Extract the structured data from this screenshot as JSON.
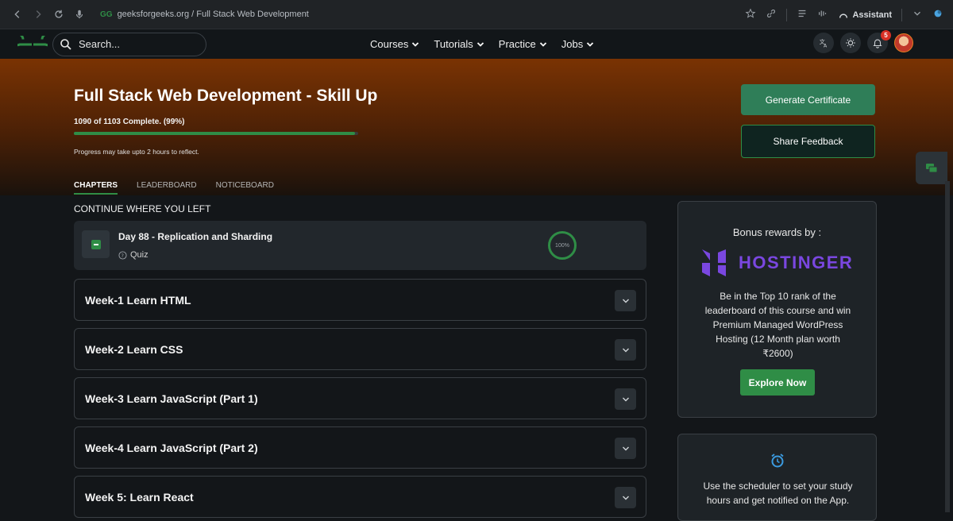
{
  "browser": {
    "url": "geeksforgeeks.org / Full Stack Web Development",
    "assistant_label": "Assistant"
  },
  "header": {
    "search_placeholder": "Search...",
    "menu": [
      {
        "label": "Courses"
      },
      {
        "label": "Tutorials"
      },
      {
        "label": "Practice"
      },
      {
        "label": "Jobs"
      }
    ],
    "notification_count": "5",
    "brand_color": "#2f8d46"
  },
  "hero": {
    "title": "Full Stack Web Development - Skill Up",
    "progress_text": "1090 of 1103 Complete. (99%)",
    "progress_fraction": 0.99,
    "progress_note": "Progress may take upto 2 hours to reflect.",
    "generate_certificate": "Generate Certificate",
    "share_feedback": "Share Feedback",
    "tabs": [
      {
        "label": "CHAPTERS"
      },
      {
        "label": "LEADERBOARD"
      },
      {
        "label": "NOTICEBOARD"
      }
    ]
  },
  "main": {
    "continue_label": "CONTINUE WHERE YOU LEFT",
    "continue_item": {
      "title": "Day 88 - Replication and Sharding",
      "type": "Quiz",
      "progress": "100%"
    },
    "weeks": [
      {
        "title": "Week-1 Learn HTML"
      },
      {
        "title": "Week-2 Learn CSS"
      },
      {
        "title": "Week-3 Learn JavaScript (Part 1)"
      },
      {
        "title": "Week-4 Learn JavaScript (Part 2)"
      },
      {
        "title": "Week 5: Learn React"
      }
    ]
  },
  "sidebar": {
    "promo": {
      "heading": "Bonus rewards by :",
      "brand": "HOSTINGER",
      "body": "Be in the Top 10 rank of the leaderboard of this course and win Premium Managed WordPress Hosting (12 Month plan worth ₹2600)",
      "button": "Explore Now"
    },
    "scheduler": {
      "text": "Use the scheduler to set your study hours and get notified on the App."
    }
  }
}
